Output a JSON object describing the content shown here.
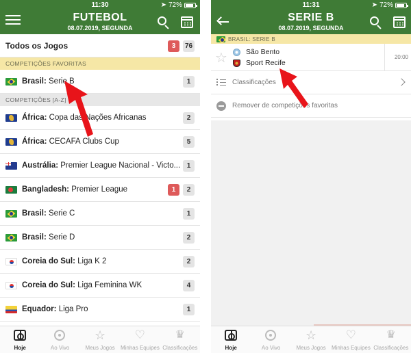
{
  "left": {
    "status": {
      "time": "11:30",
      "battery": "72%",
      "battery_level": 0.72
    },
    "header": {
      "title": "FUTEBOL",
      "date": "08.07.2019, SEGUNDA"
    },
    "all_games": {
      "label": "Todos os Jogos",
      "live_count": "3",
      "total_count": "76"
    },
    "fav_section": "COMPETIÇÕES FAVORITAS",
    "favorites": [
      {
        "country": "Brasil:",
        "league": "Serie B",
        "count": "1",
        "flag": "br"
      }
    ],
    "az_section": "COMPETIÇÕES [A-Z]",
    "competitions": [
      {
        "country": "África:",
        "league": "Copa das Nações Africanas",
        "count": "2",
        "live": "",
        "flag": "af"
      },
      {
        "country": "África:",
        "league": "CECAFA Clubs Cup",
        "count": "5",
        "live": "",
        "flag": "af"
      },
      {
        "country": "Austrália:",
        "league": "Premier League Nacional - Victo...",
        "count": "1",
        "live": "",
        "flag": "au"
      },
      {
        "country": "Bangladesh:",
        "league": "Premier League",
        "count": "2",
        "live": "1",
        "flag": "bd"
      },
      {
        "country": "Brasil:",
        "league": "Serie C",
        "count": "1",
        "live": "",
        "flag": "br"
      },
      {
        "country": "Brasil:",
        "league": "Serie D",
        "count": "2",
        "live": "",
        "flag": "br"
      },
      {
        "country": "Coreia do Sul:",
        "league": "Liga K 2",
        "count": "2",
        "live": "",
        "flag": "kr"
      },
      {
        "country": "Coreia do Sul:",
        "league": "Liga Feminina WK",
        "count": "4",
        "live": "",
        "flag": "kr"
      },
      {
        "country": "Equador:",
        "league": "Liga Pro",
        "count": "1",
        "live": "",
        "flag": "ec"
      }
    ]
  },
  "right": {
    "status": {
      "time": "11:31",
      "battery": "72%",
      "battery_level": 0.72
    },
    "header": {
      "title": "SERIE B",
      "date": "08.07.2019, SEGUNDA"
    },
    "section": "BRASIL: SERIE B",
    "match": {
      "home": "São Bento",
      "away": "Sport Recife",
      "time": "20:00"
    },
    "options": {
      "standings": "Classificações",
      "remove_fav": "Remover de competições favoritas"
    }
  },
  "tabs": [
    {
      "label": "Hoje",
      "icon": "field-icon",
      "active": true
    },
    {
      "label": "Ao Vivo",
      "icon": "live-icon",
      "active": false
    },
    {
      "label": "Meus Jogos",
      "icon": "star-icon",
      "active": false
    },
    {
      "label": "Minhas Equipes",
      "icon": "heart-icon",
      "active": false
    },
    {
      "label": "Classificações",
      "icon": "trophy-icon",
      "active": false
    }
  ],
  "colors": {
    "header_green": "#3f7b36",
    "favorite_band": "#f6e7a6",
    "live_badge": "#de5a5a",
    "arrow_red": "#e8141a"
  }
}
